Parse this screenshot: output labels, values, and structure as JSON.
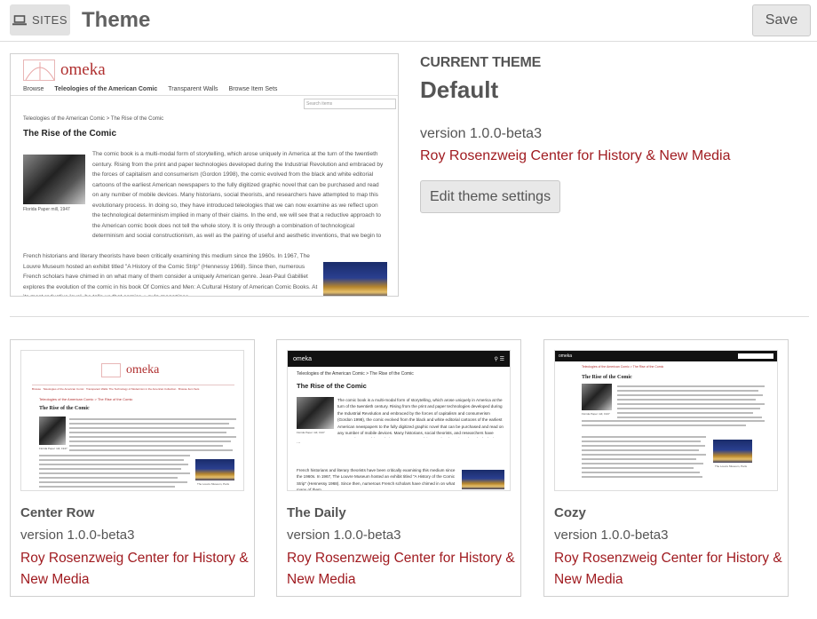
{
  "header": {
    "sites_label": "SITES",
    "sites_icon": "laptop-icon",
    "title": "Theme",
    "save_label": "Save"
  },
  "current": {
    "label": "CURRENT THEME",
    "name": "Default",
    "version": "version 1.0.0-beta3",
    "author": "Roy Rosenzweig Center for History & New Media",
    "edit_label": "Edit theme settings",
    "preview": {
      "logo": "omeka",
      "nav": [
        "Browse",
        "Teleologies of the American Comic",
        "Transparent Walls",
        "Browse Item Sets"
      ],
      "search_placeholder": "Search items",
      "breadcrumb": "Teleologies of the American Comic > The Rise of the Comic",
      "article_title": "The Rise of the Comic",
      "caption": "Florida Paper mill, 1947",
      "para1": "The comic book is a multi-modal form of storytelling, which arose uniquely in America at the turn of the twentieth century. Rising from the print and paper technologies developed during the Industrial Revolution and embraced by the forces of capitalism and consumerism (Gordon 1998), the comic evolved from the black and white editorial cartoons of the earliest American newspapers to the fully digitized graphic novel that can be purchased and read on any number of mobile devices. Many historians, social theorists, and researchers have attempted to map this evolutionary process. In doing so, they have introduced teleologies that we can now examine as we reflect upon the technological determinism implied in many of their claims. In the end, we will see that a reductive approach to the American comic book does not tell the whole story. It is only through a combination of technological determinism and social constructionism, as well as the pairing of useful and aesthetic inventions, that we begin to understand the full history of the American comic book.",
      "para2": "French historians and literary theorists have been critically examining this medium since the 1960s. In 1967, The Louvre Museum hosted an exhibit titled \"A History of the Comic Strip\" (Hennessy 1968). Since then, numerous French scholars have chimed in on what many of them consider a uniquely American genre. Jean-Paul Gabilliet explores the evolution of the comic in his book Of Comics and Men: A Cultural History of American Comic Books. At its most reductive level, he tells us that comics + pulp magazines ="
    }
  },
  "themes": [
    {
      "name": "Center Row",
      "version": "version 1.0.0-beta3",
      "author": "Roy Rosenzweig Center for History & New Media",
      "preview": {
        "logo": "omeka",
        "nav": [
          "Browse",
          "Teleologies of the American Comic",
          "Transparent Walls: The Technology of Modernism in the American Collection",
          "Browse Item Sets"
        ],
        "breadcrumb": "Teleologies of the American Comic > The Rise of the Comic",
        "article_title": "The Rise of the Comic",
        "caption": "Florida Paper mill, 1947",
        "caption2": "The Louvre Museum, Paris"
      }
    },
    {
      "name": "The Daily",
      "version": "version 1.0.0-beta3",
      "author": "Roy Rosenzweig Center for History & New Media",
      "preview": {
        "logo": "omeka",
        "breadcrumb": "Teleologies of the American Comic > The Rise of the Comic",
        "article_title": "The Rise of the Comic",
        "caption": "Florida Paper mill, 1947",
        "para1": "The comic book is a multi-modal form of storytelling, which arose uniquely in America at the turn of the twentieth century. Rising from the print and paper technologies developed during the Industrial Revolution and embraced by the forces of capitalism and consumerism (Gordon 1998), the comic evolved from the black and white editorial cartoons of the earliest American newspapers to the fully digitized graphic novel that can be purchased and read on any number of mobile devices. Many historians, social theorists, and researchers have attempted to map this evolutionary process. In doing so, they have introduced teleologies that we can now examine as we reflect upon the technological determinism implied in many of their claims. In the end, we will see that a reductive approach to the American comic book does not tell the whole story. It is only through a combination of technological determinism and social constructionism, as well as the pairing of useful and aesthetic inventions, that we begin to understand the full history of the American comic book.",
        "para2": "French historians and literary theorists have been critically examining this medium since the 1960s. In 1967, The Louvre Museum hosted an exhibit titled \"A History of the Comic Strip\" (Hennessy 1968). Since then, numerous French scholars have chimed in on what many of them"
      }
    },
    {
      "name": "Cozy",
      "version": "version 1.0.0-beta3",
      "author": "Roy Rosenzweig Center for History & New Media",
      "preview": {
        "logo": "omeka",
        "breadcrumb": "Teleologies of the American Comic > The Rise of the Comic",
        "article_title": "The Rise of the Comic",
        "caption": "Florida Paper mill, 1947",
        "caption2": "The Louvre Museum, Paris"
      }
    }
  ]
}
